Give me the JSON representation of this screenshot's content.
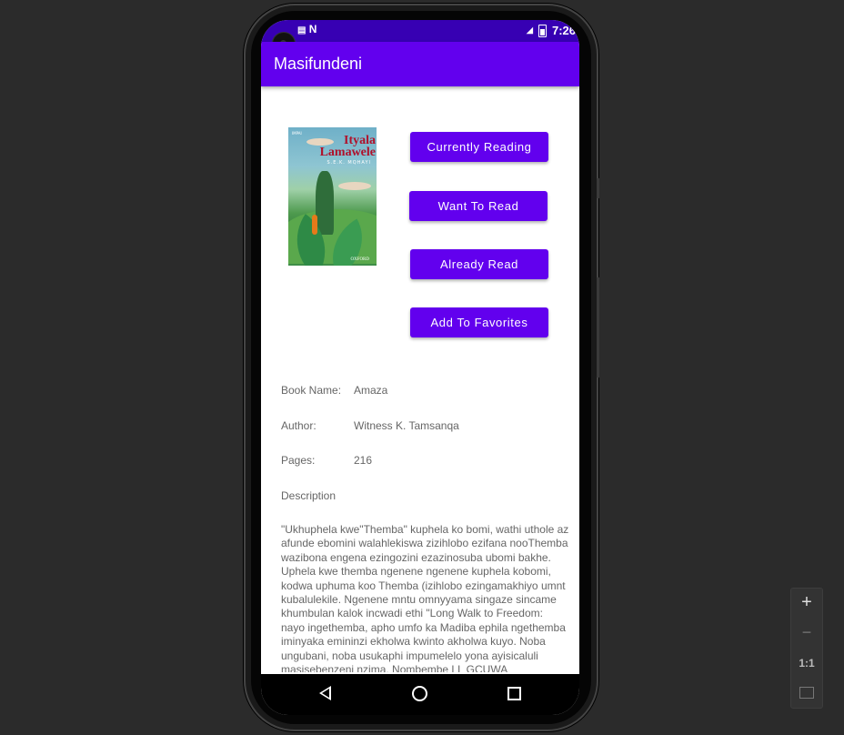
{
  "status_bar": {
    "left_icons": "N",
    "time": "7:26"
  },
  "app_bar": {
    "title": "Masifundeni"
  },
  "cover": {
    "title_line1": "Ityala",
    "title_line2": "Lamawele",
    "author": "S.E.K. MQHAYI",
    "publisher": "OXFORD",
    "top_label": "IMPAI"
  },
  "buttons": {
    "currently_reading": "Currently Reading",
    "want_to_read": "Want To Read",
    "already_read": "Already Read",
    "add_to_favorites": "Add To Favorites"
  },
  "details": {
    "book_name_label": "Book Name:",
    "book_name_value": "Amaza",
    "author_label": "Author:",
    "author_value": "Witness K. Tamsanqa",
    "pages_label": "Pages:",
    "pages_value": "216",
    "description_label": "Description",
    "description_text": "\"Ukhuphela kwe\"Themba\" kuphela ko bomi, wathi uthole az\nafunde ebomini walahlekiswa zizihlobo ezifana nooThemba\nwazibona engena ezingozini ezazinosuba ubomi bakhe.\nUphela kwe themba ngenene ngenene kuphela kobomi,\nkodwa uphuma koo Themba (izihlobo ezingamakhiyo umnt\nkubalulekile. Ngenene mntu omnyyama singaze sincame\nkhumbulan kalok incwadi ethi \"Long Walk to Freedom:\nnayo ingethemba, apho umfo ka Madiba ephila ngethemba\niminyaka emininzi ekholwa kwinto akholwa kuyo. Noba\nungubani, noba usukaphi impumelelo yona ayisicaluli\nmasisebenzeni nzima. Nombembe LL GCUWA"
  },
  "zoom_panel": {
    "plus": "+",
    "minus": "−",
    "ratio": "1:1"
  },
  "colors": {
    "primary": "#6200ee",
    "primary_dark": "#3700b3",
    "text_secondary": "#666666"
  }
}
